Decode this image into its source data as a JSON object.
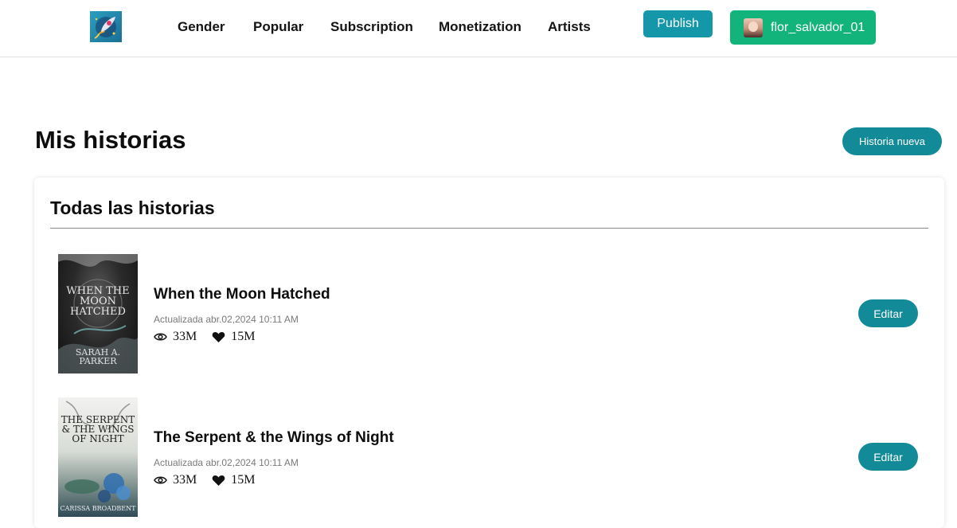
{
  "header": {
    "nav": [
      {
        "label": "Gender"
      },
      {
        "label": "Popular"
      },
      {
        "label": "Subscription"
      },
      {
        "label": "Monetization"
      },
      {
        "label": "Artists"
      }
    ],
    "publish_label": "Publish",
    "username": "flor_salvador_01"
  },
  "page": {
    "title": "Mis historias",
    "new_story_label": "Historia nueva"
  },
  "card": {
    "title": "Todas las historias"
  },
  "stories": [
    {
      "title": "When the Moon Hatched",
      "updated": "Actualizada abr.02,2024 10:11 AM",
      "views": "33M",
      "likes": "15M",
      "edit_label": "Editar",
      "cover_title": "WHEN THE MOON HATCHED",
      "cover_author": "SARAH A. PARKER"
    },
    {
      "title": "The Serpent & the Wings of Night",
      "updated": "Actualizada abr.02,2024 10:11 AM",
      "views": "33M",
      "likes": "15M",
      "edit_label": "Editar",
      "cover_title": "THE SERPENT & THE WINGS OF NIGHT",
      "cover_author": "CARISSA BROADBENT"
    }
  ],
  "colors": {
    "publish": "#1497a9",
    "user_button": "#13b47c",
    "teal_button": "#138a98"
  }
}
